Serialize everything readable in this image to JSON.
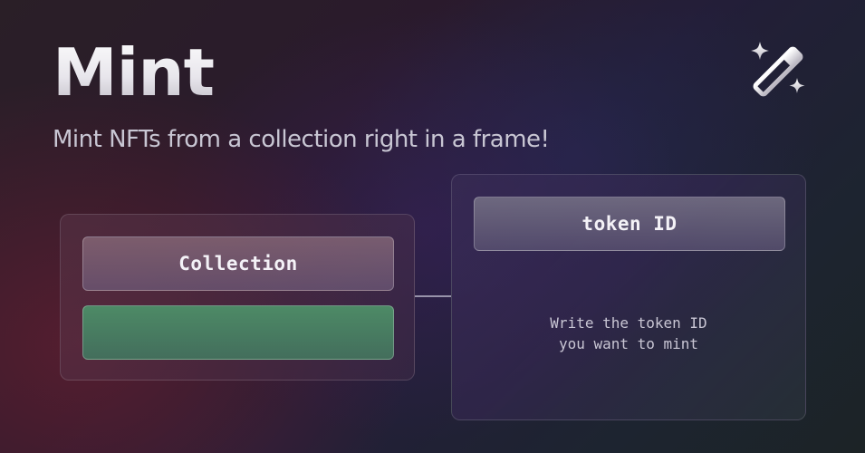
{
  "header": {
    "title": "Mint",
    "subtitle": "Mint NFTs from a collection right in a frame!",
    "icon": "magic-wand-icon"
  },
  "left_node": {
    "collection_label": "Collection",
    "action_color": "#4d8a66"
  },
  "right_node": {
    "token_label": "token ID",
    "hint_line1": "Write the token ID",
    "hint_line2": "you want to mint"
  },
  "colors": {
    "title_gradient_top": "#ffffff",
    "subtitle": "#c8c6d3",
    "connector": "#c8c4d6"
  }
}
